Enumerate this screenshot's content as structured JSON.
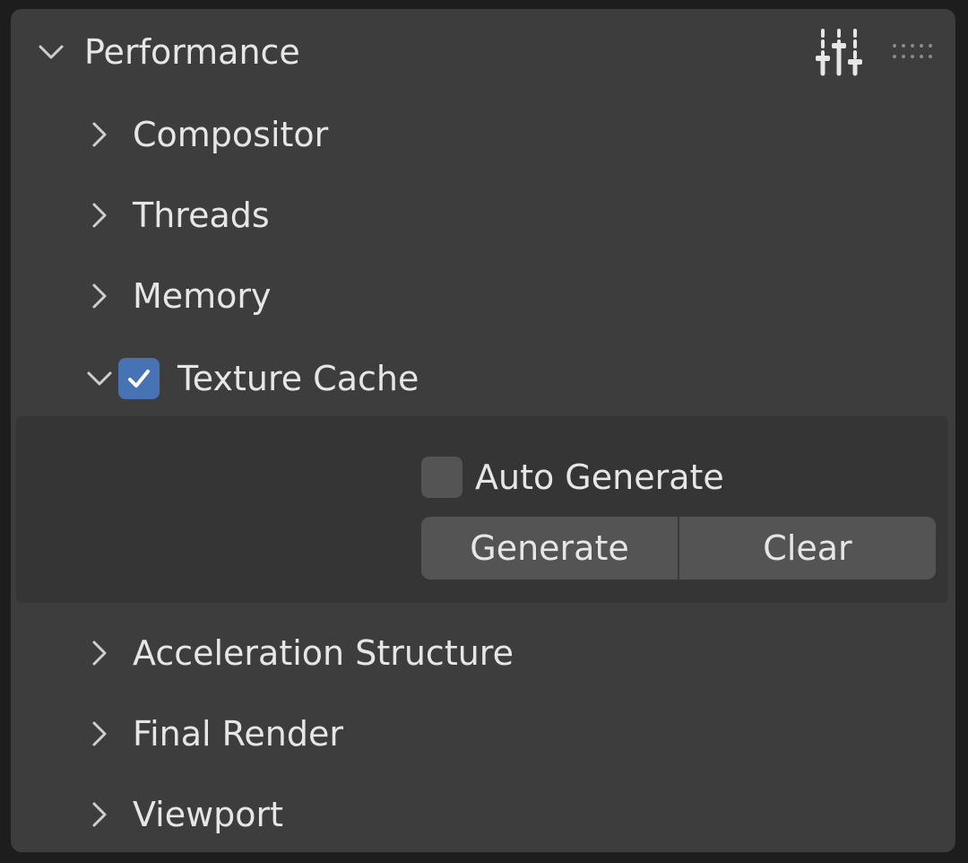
{
  "panel": {
    "title": "Performance",
    "expanded": true
  },
  "header_tools": {
    "presets_icon": "sliders-icon",
    "drag_icon": "drag-handle-icon"
  },
  "sections": [
    {
      "label": "Compositor",
      "expanded": false
    },
    {
      "label": "Threads",
      "expanded": false
    },
    {
      "label": "Memory",
      "expanded": false
    },
    {
      "label": "Texture Cache",
      "expanded": true,
      "checked": true
    },
    {
      "label": "Acceleration Structure",
      "expanded": false
    },
    {
      "label": "Final Render",
      "expanded": false
    },
    {
      "label": "Viewport",
      "expanded": false
    }
  ],
  "texture_cache": {
    "auto_generate_label": "Auto Generate",
    "auto_generate_checked": false,
    "generate_label": "Generate",
    "clear_label": "Clear"
  },
  "colors": {
    "panel_bg": "#3d3d3d",
    "subpanel_bg": "#353535",
    "checkbox_on": "#4772b3",
    "checkbox_off": "#545454",
    "button_bg": "#545454",
    "text": "#e6e6e6"
  }
}
